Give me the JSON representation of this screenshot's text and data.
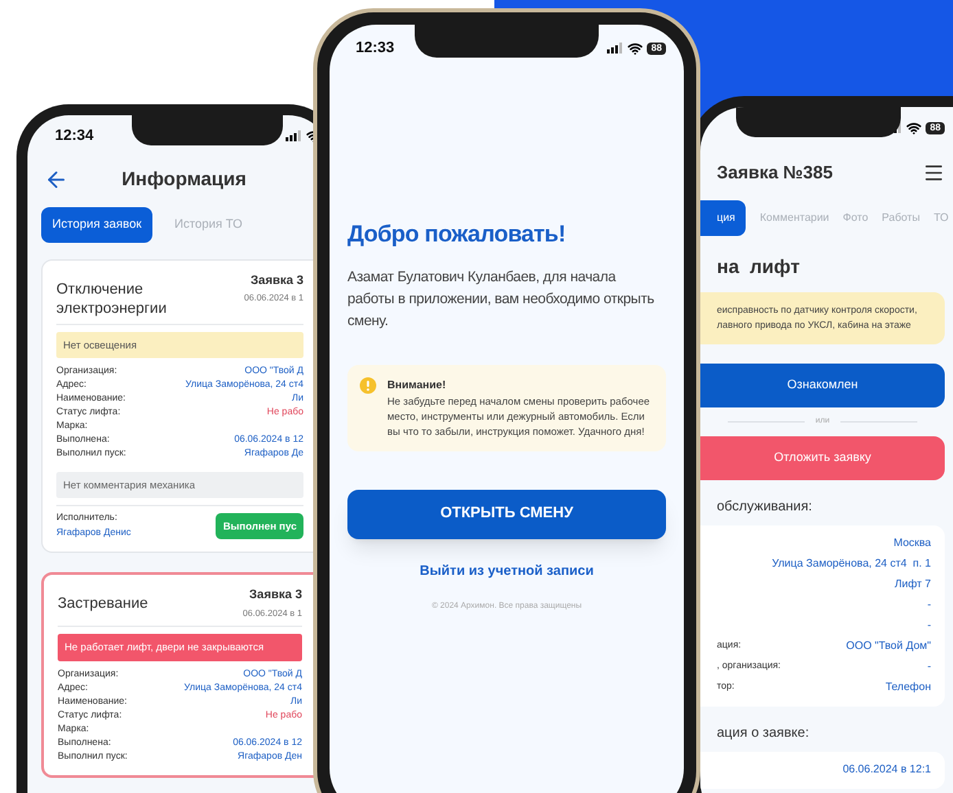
{
  "left_phone": {
    "status_bar": {
      "time": "12:34"
    },
    "title": "Информация",
    "tabs": [
      {
        "label": "История заявок",
        "selected": true
      },
      {
        "label": "История ТО",
        "selected": false
      }
    ],
    "cards": [
      {
        "title": "Отключение электроэнергии",
        "number": "Заявка 3",
        "date": "06.06.2024 в 1",
        "urgent": false,
        "note": "Нет освещения",
        "rows": [
          {
            "label": "Организация:",
            "value": "ООО \"Твой Д",
            "kind": "link"
          },
          {
            "label": "Адрес:",
            "value": "Улица Заморёнова, 24 ст4",
            "kind": "link"
          },
          {
            "label": "Наименование:",
            "value": "Ли",
            "kind": "link"
          },
          {
            "label": "Статус лифта:",
            "value": "Не рабо",
            "kind": "alert"
          },
          {
            "label": "Марка:"
          },
          {
            "label": "Выполнена:",
            "value": "06.06.2024 в 12",
            "kind": "link"
          },
          {
            "label": "Выполнил пуск:",
            "value": "Ягафаров Де",
            "kind": "link"
          }
        ],
        "comment": "Нет комментария механика",
        "executor_label": "Исполнитель:",
        "executor": "Ягафаров Денис",
        "status": "Выполнен пус"
      },
      {
        "title": "Застревание",
        "number": "Заявка 3",
        "date": "06.06.2024 в 1",
        "urgent": true,
        "note": "Не работает лифт, двери не закрываются",
        "rows": [
          {
            "label": "Организация:",
            "value": "ООО \"Твой Д",
            "kind": "link"
          },
          {
            "label": "Адрес:",
            "value": "Улица Заморёнова, 24 ст4",
            "kind": "link"
          },
          {
            "label": "Наименование:",
            "value": "Ли",
            "kind": "link"
          },
          {
            "label": "Статус лифта:",
            "value": "Не рабо",
            "kind": "alert"
          },
          {
            "label": "Марка:"
          },
          {
            "label": "Выполнена:",
            "value": "06.06.2024 в 12",
            "kind": "link"
          },
          {
            "label": "Выполнил пуск:",
            "value": "Ягафаров Ден",
            "kind": "link"
          }
        ]
      }
    ]
  },
  "center_phone": {
    "status_bar": {
      "time": "12:33",
      "battery": "88"
    },
    "title": "Добро пожаловать!",
    "text": "Азамат Булатович Куланбаев, для начала работы в приложении, вам необходимо открыть смену.",
    "notice": {
      "title": "Внимание!",
      "text": "Не забудьте перед началом смены проверить рабочее место, инструменты или дежурный автомобиль. Если вы что то забыли, инструкция поможет. Удачного дня!"
    },
    "button": "ОТКРЫТЬ СМЕНУ",
    "link": "Выйти из учетной записи",
    "footer": "© 2024 Архимон. Все права защищены"
  },
  "right_phone": {
    "status_bar": {
      "battery": "88"
    },
    "title": "Заявка №385",
    "tabs": [
      {
        "label": "ция",
        "selected": true
      },
      {
        "label": "Комментарии",
        "selected": false
      },
      {
        "label": "Фото",
        "selected": false
      },
      {
        "label": "Работы",
        "selected": false
      },
      {
        "label": "ТО",
        "selected": false
      }
    ],
    "heading": "на  лифт",
    "notice_lines": [
      "еисправность по датчику контроля скорости,",
      "лавного привода по УКСЛ, кабина на этаже"
    ],
    "primary_button": "Ознакомлен",
    "separator": "или",
    "danger_button": "Отложить заявку",
    "sections": [
      {
        "title": "обслуживания:",
        "rows": [
          {
            "value": "Москва"
          },
          {
            "value": "Улица Заморёнова, 24 ст4  п. 1"
          },
          {
            "value": "Лифт 7"
          },
          {
            "value": "-"
          },
          {
            "value": "-"
          },
          {
            "label": "ация:",
            "value": "ООО \"Твой Дом\""
          },
          {
            "label": ", организация:",
            "value": "-"
          },
          {
            "label": "тор:",
            "value": "Телефон"
          }
        ]
      },
      {
        "title": "ация о заявке:",
        "rows": [
          {
            "value": "06.06.2024 в 12:1"
          }
        ]
      }
    ]
  }
}
